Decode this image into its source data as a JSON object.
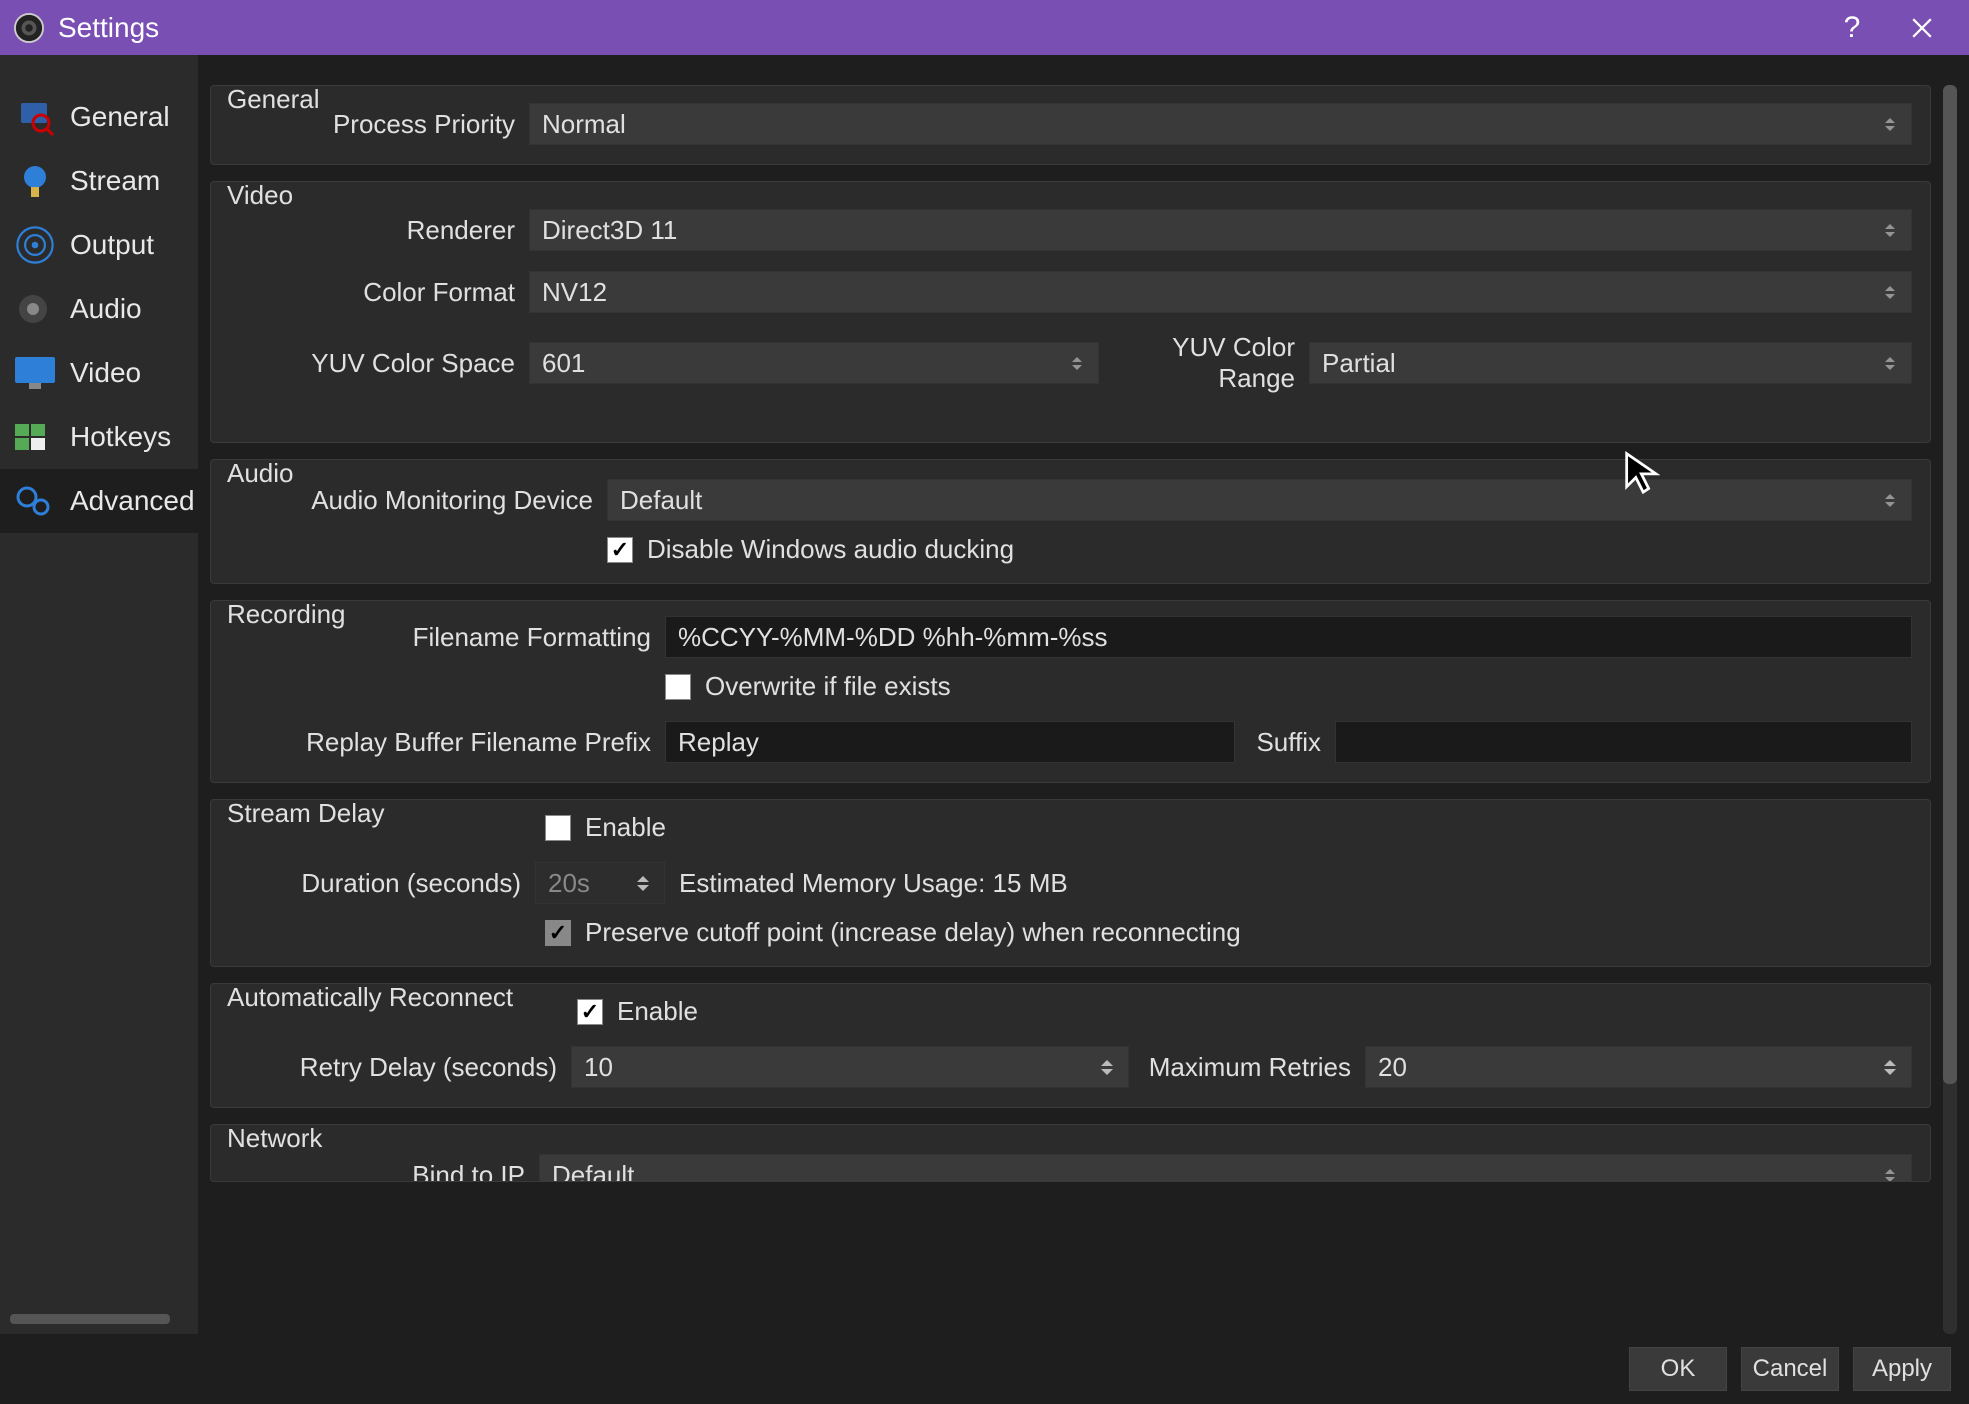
{
  "title": "Settings",
  "sidebar": [
    "General",
    "Stream",
    "Output",
    "Audio",
    "Video",
    "Hotkeys",
    "Advanced"
  ],
  "general": {
    "title": "General",
    "process_priority_label": "Process Priority",
    "process_priority": "Normal"
  },
  "video": {
    "title": "Video",
    "renderer_label": "Renderer",
    "renderer": "Direct3D 11",
    "color_format_label": "Color Format",
    "color_format": "NV12",
    "yuv_space_label": "YUV Color Space",
    "yuv_space": "601",
    "yuv_range_label": "YUV Color Range",
    "yuv_range": "Partial"
  },
  "audio": {
    "title": "Audio",
    "monitoring_label": "Audio Monitoring Device",
    "monitoring": "Default",
    "ducking_label": "Disable Windows audio ducking"
  },
  "recording": {
    "title": "Recording",
    "filename_formatting_label": "Filename Formatting",
    "filename_formatting": "%CCYY-%MM-%DD %hh-%mm-%ss",
    "overwrite_label": "Overwrite if file exists",
    "prefix_label": "Replay Buffer Filename Prefix",
    "prefix": "Replay",
    "suffix_label": "Suffix",
    "suffix": ""
  },
  "stream_delay": {
    "title": "Stream Delay",
    "enable_label": "Enable",
    "duration_label": "Duration (seconds)",
    "duration": "20s",
    "estimated": "Estimated Memory Usage: 15 MB",
    "preserve_label": "Preserve cutoff point (increase delay) when reconnecting"
  },
  "reconnect": {
    "title": "Automatically Reconnect",
    "enable_label": "Enable",
    "retry_delay_label": "Retry Delay (seconds)",
    "retry_delay": "10",
    "max_retries_label": "Maximum Retries",
    "max_retries": "20"
  },
  "network": {
    "title": "Network",
    "bind_ip_label": "Bind to IP",
    "bind_ip": "Default"
  },
  "footer": {
    "ok": "OK",
    "cancel": "Cancel",
    "apply": "Apply"
  }
}
